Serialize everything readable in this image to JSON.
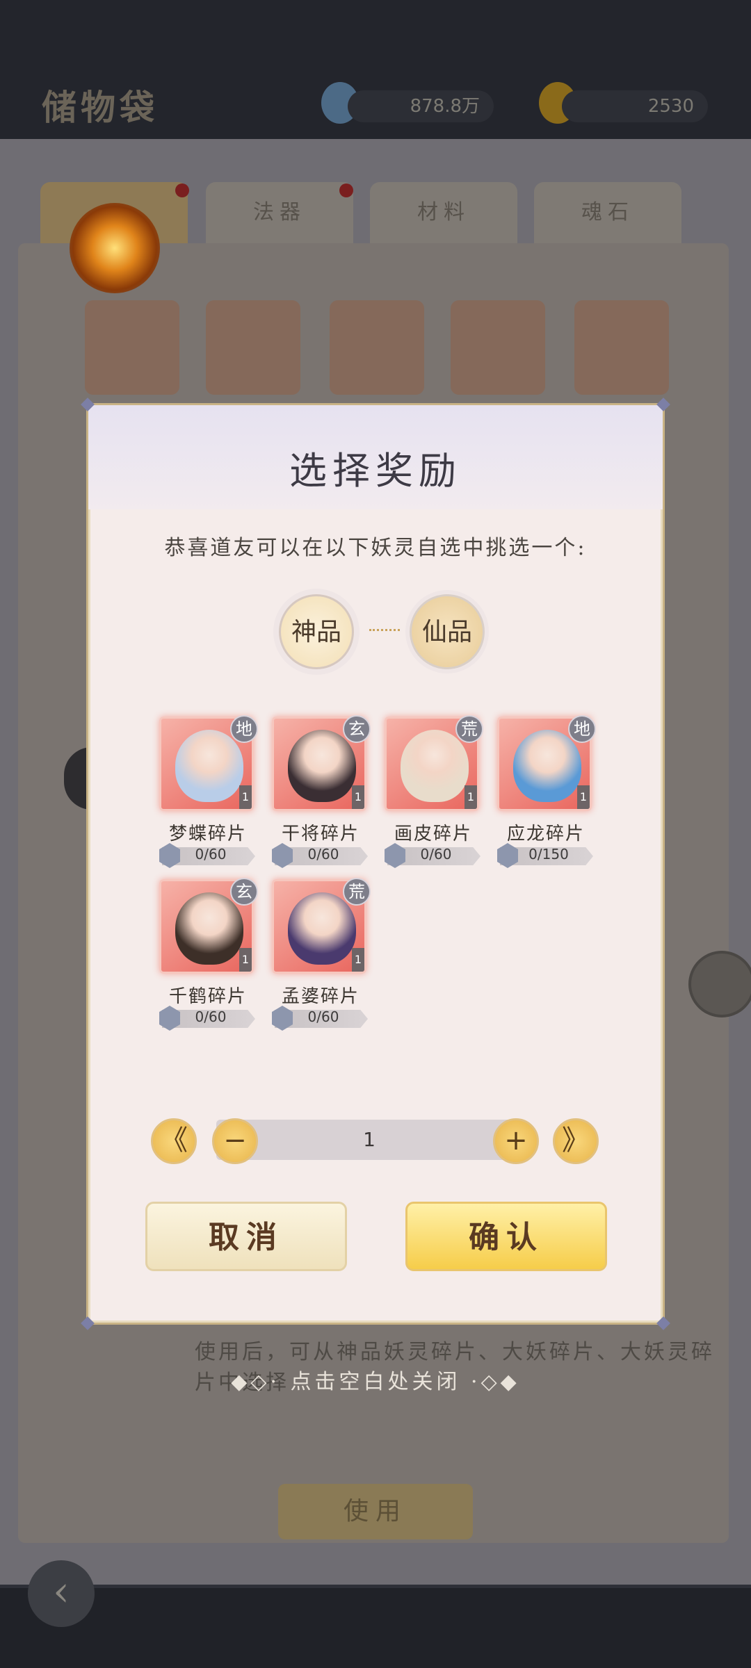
{
  "background": {
    "title": "储物袋",
    "resources": [
      {
        "icon": "jade-icon",
        "value": "878.8万"
      },
      {
        "icon": "lightning-icon",
        "value": "2530"
      }
    ],
    "tabs": [
      "",
      "法器",
      "材料",
      "魂石"
    ],
    "description": "使用后，可从神品妖灵碎片、大妖碎片、大妖灵碎片中选择",
    "use_label": "使用",
    "back_icon": "back-arrow-icon"
  },
  "dialog": {
    "title": "选择奖励",
    "prompt": "恭喜道友可以在以下妖灵自选中挑选一个:",
    "grades": [
      {
        "label": "神品",
        "selected": true
      },
      {
        "label": "仙品",
        "selected": false
      }
    ],
    "items": [
      {
        "name": "梦蝶碎片",
        "grade": "地",
        "count": "1",
        "progress": "0/60",
        "portrait": "#b9cde8"
      },
      {
        "name": "干将碎片",
        "grade": "玄",
        "count": "1",
        "progress": "0/60",
        "portrait": "#3a2e33"
      },
      {
        "name": "画皮碎片",
        "grade": "荒",
        "count": "1",
        "progress": "0/60",
        "portrait": "#e8dccb"
      },
      {
        "name": "应龙碎片",
        "grade": "地",
        "count": "1",
        "progress": "0/150",
        "portrait": "#5a9ad6"
      },
      {
        "name": "千鹤碎片",
        "grade": "玄",
        "count": "1",
        "progress": "0/60",
        "portrait": "#3d2f28"
      },
      {
        "name": "孟婆碎片",
        "grade": "荒",
        "count": "1",
        "progress": "0/60",
        "portrait": "#4a3a6e"
      }
    ],
    "quantity": {
      "value": "1",
      "min_label": "《",
      "minus_label": "−",
      "plus_label": "+",
      "max_label": "》"
    },
    "cancel_label": "取消",
    "confirm_label": "确认"
  },
  "close_hint": "◆◇· 点击空白处关闭 ·◇◆"
}
